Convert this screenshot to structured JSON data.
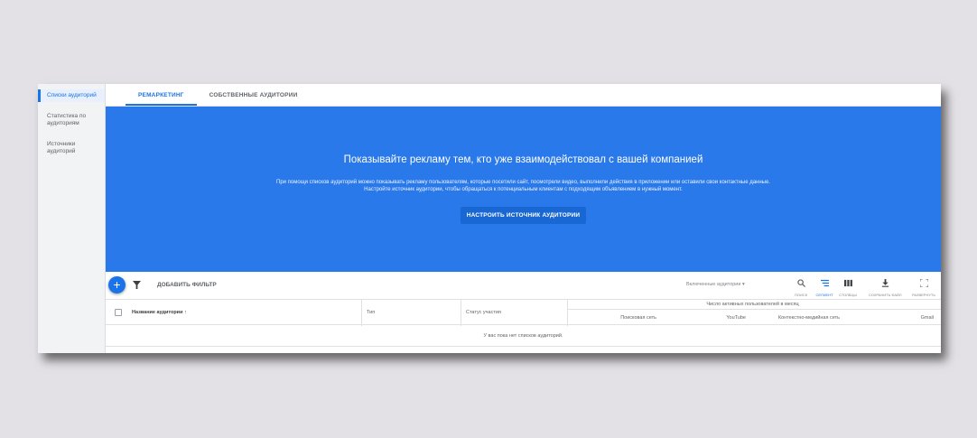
{
  "sidebar": {
    "items": [
      {
        "label": "Списки аудиторий"
      },
      {
        "label": "Статистика по аудиториям"
      },
      {
        "label": "Источники аудиторий"
      }
    ]
  },
  "tabs": [
    {
      "label": "РЕМАРКЕТИНГ"
    },
    {
      "label": "СОБСТВЕННЫЕ АУДИТОРИИ"
    }
  ],
  "hero": {
    "title": "Показывайте рекламу тем, кто уже взаимодействовал с вашей компанией",
    "line1": "При помощи списков аудиторий можно показывать рекламу пользователям, которые посетили сайт, посмотрели видео, выполнили действия в приложении или оставили свои контактные данные.",
    "line2": "Настройте источник аудитории, чтобы обращаться к потенциальным клиентам с подходящим объявлением в нужный момент.",
    "button": "НАСТРОИТЬ ИСТОЧНИК АУДИТОРИИ"
  },
  "toolbar": {
    "add_filter": "ДОБАВИТЬ ФИЛЬТР",
    "view_select": "Включенные аудитории",
    "tools": [
      {
        "label": "Поиск",
        "icon": "search-icon"
      },
      {
        "label": "Сегмент",
        "icon": "segment-icon"
      },
      {
        "label": "Столбцы",
        "icon": "columns-icon"
      },
      {
        "label": "Сохранить файл",
        "icon": "download-icon"
      },
      {
        "label": "Развернуть",
        "icon": "fullscreen-icon"
      }
    ]
  },
  "table": {
    "headers": {
      "name": "Название аудитории",
      "type": "Тип",
      "status": "Статус участия",
      "group": "Число активных пользователей в месяц",
      "search": "Поисковая сеть",
      "youtube": "YouTube",
      "display": "Контекстно-медийная сеть",
      "gmail": "Gmail"
    },
    "empty": "У вас пока нет списков аудиторий."
  },
  "colors": {
    "accent": "#1a73e8",
    "hero": "#2a79ea",
    "sidebar": "#f1f3f4"
  }
}
